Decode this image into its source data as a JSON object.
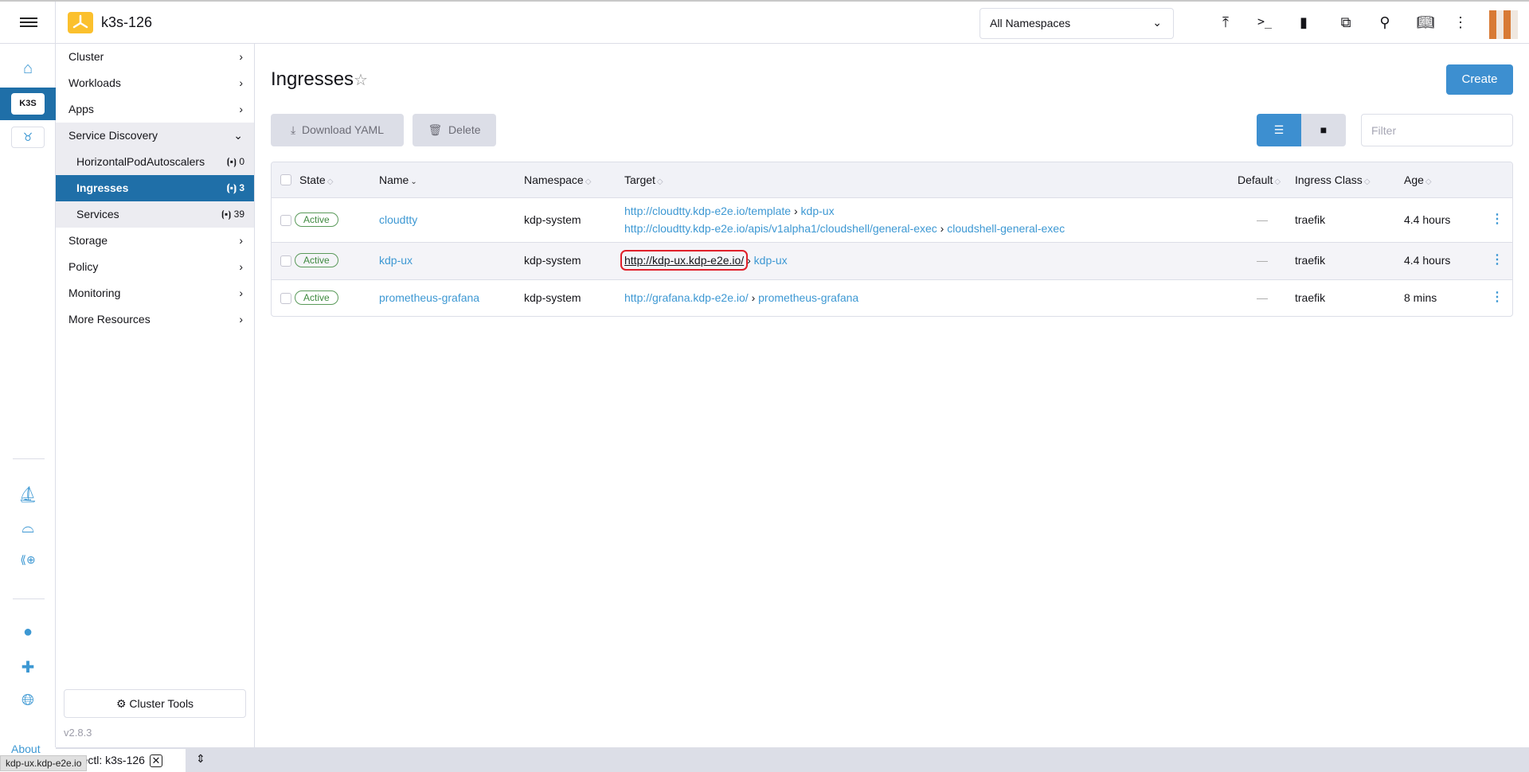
{
  "header": {
    "cluster_name": "k3s-126",
    "namespace_select": "All Namespaces"
  },
  "rail": {
    "cluster_badge": "K3S",
    "about": "About"
  },
  "nav": {
    "items": [
      {
        "label": "Cluster"
      },
      {
        "label": "Workloads"
      },
      {
        "label": "Apps"
      },
      {
        "label": "Service Discovery"
      },
      {
        "label": "HorizontalPodAutoscalers",
        "count": "0"
      },
      {
        "label": "Ingresses",
        "count": "3"
      },
      {
        "label": "Services",
        "count": "39"
      },
      {
        "label": "Storage"
      },
      {
        "label": "Policy"
      },
      {
        "label": "Monitoring"
      },
      {
        "label": "More Resources"
      }
    ],
    "cluster_tools": "Cluster Tools",
    "version": "v2.8.3"
  },
  "main": {
    "title": "Ingresses",
    "create": "Create",
    "download_yaml": "Download YAML",
    "delete": "Delete",
    "filter_placeholder": "Filter",
    "columns": [
      "State",
      "Name",
      "Namespace",
      "Target",
      "Default",
      "Ingress Class",
      "Age"
    ],
    "rows": [
      {
        "state": "Active",
        "name": "cloudtty",
        "namespace": "kdp-system",
        "targets": [
          {
            "url": "http://cloudtty.kdp-e2e.io/template",
            "service": "kdp-ux"
          },
          {
            "url": "http://cloudtty.kdp-e2e.io/apis/v1alpha1/cloudshell/general-exec",
            "service": "cloudshell-general-exec"
          }
        ],
        "default": "—",
        "ingress_class": "traefik",
        "age": "4.4 hours"
      },
      {
        "state": "Active",
        "name": "kdp-ux",
        "namespace": "kdp-system",
        "targets": [
          {
            "url": "http://kdp-ux.kdp-e2e.io/",
            "service": "kdp-ux"
          }
        ],
        "default": "—",
        "ingress_class": "traefik",
        "age": "4.4 hours"
      },
      {
        "state": "Active",
        "name": "prometheus-grafana",
        "namespace": "kdp-system",
        "targets": [
          {
            "url": "http://grafana.kdp-e2e.io/",
            "service": "prometheus-grafana"
          }
        ],
        "default": "—",
        "ingress_class": "traefik",
        "age": "8 mins"
      }
    ]
  },
  "bottom": {
    "kubectl_tab": "kubectl: k3s-126",
    "status_url": "kdp-ux.kdp-e2e.io"
  },
  "colors": {
    "accent": "#3d8fd0",
    "nav_active": "#1f6fa8",
    "highlight": "#e0202a"
  }
}
